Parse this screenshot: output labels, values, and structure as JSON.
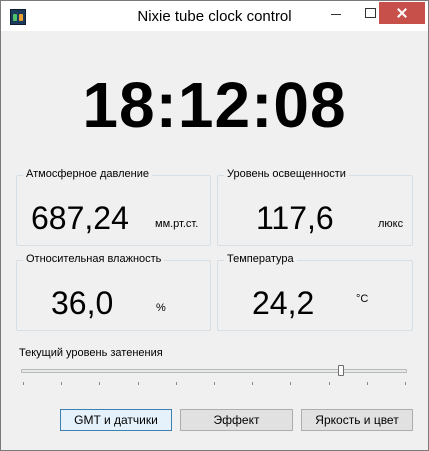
{
  "window": {
    "title": "Nixie tube clock control"
  },
  "clock": {
    "time": "18:12:08"
  },
  "sensors": {
    "pressure": {
      "label": "Атмосферное давление",
      "value": "687,24",
      "unit": "мм.рт.ст."
    },
    "illuminance": {
      "label": "Уровень освещенности",
      "value": "117,6",
      "unit": "люкс"
    },
    "humidity": {
      "label": "Относительная влажность",
      "value": "36,0",
      "unit": "%"
    },
    "temperature": {
      "label": "Температура",
      "value": "24,2",
      "unit": "°C"
    }
  },
  "dimming": {
    "label": "Текущий уровень затенения",
    "level": 0.83,
    "tick_count": 11
  },
  "buttons": {
    "gmt": "GMT и датчики",
    "effect": "Эффект",
    "brightness": "Яркость и цвет"
  },
  "icons": {
    "app": "nixie-tube-icon",
    "minimize": "minimize-icon",
    "maximize": "maximize-icon",
    "close": "close-icon"
  }
}
